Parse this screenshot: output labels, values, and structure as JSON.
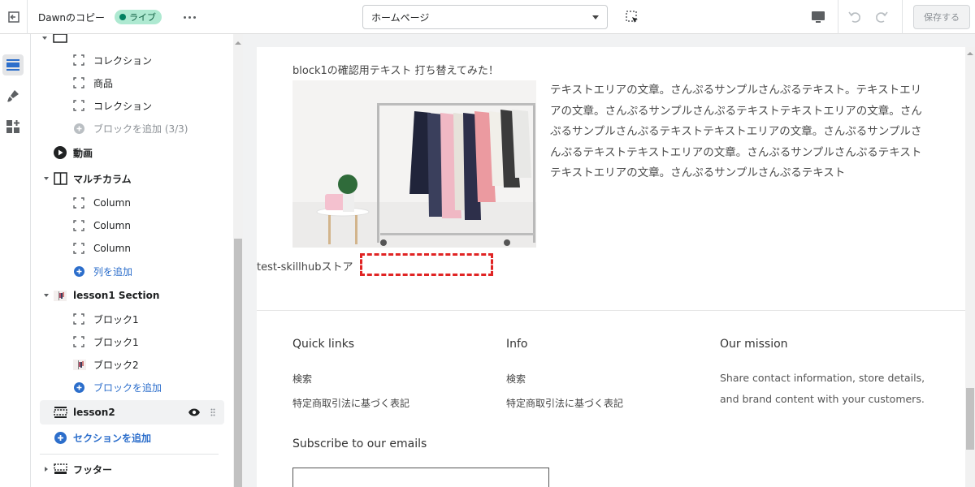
{
  "topbar": {
    "theme_name": "Dawnのコピー",
    "status_badge": "ライブ",
    "page_selector_value": "ホームページ",
    "save_label": "保存する"
  },
  "sidebar": {
    "items": [
      {
        "label": "コレクション",
        "icon": "block-icon"
      },
      {
        "label": "商品",
        "icon": "block-icon"
      },
      {
        "label": "コレクション",
        "icon": "block-icon"
      },
      {
        "label": "ブロックを追加 (3/3)",
        "icon": "add-circle-icon"
      },
      {
        "label": "動画",
        "icon": "play-icon"
      },
      {
        "label": "マルチカラム",
        "icon": "columns-icon"
      },
      {
        "label": "Column",
        "icon": "block-icon"
      },
      {
        "label": "Column",
        "icon": "block-icon"
      },
      {
        "label": "Column",
        "icon": "block-icon"
      },
      {
        "label": "列を追加",
        "icon": "add-circle-icon"
      },
      {
        "label": "lesson1 Section",
        "icon": "image-thumb-icon"
      },
      {
        "label": "ブロック1",
        "icon": "block-icon"
      },
      {
        "label": "ブロック1",
        "icon": "block-icon"
      },
      {
        "label": "ブロック2",
        "icon": "image-thumb-icon"
      },
      {
        "label": "ブロックを追加",
        "icon": "add-circle-icon"
      },
      {
        "label": "lesson2",
        "icon": "section-icon"
      },
      {
        "label": "セクションを追加",
        "icon": "add-circle-icon"
      },
      {
        "label": "フッター",
        "icon": "footer-icon"
      }
    ]
  },
  "preview": {
    "block_caption": "block1の確認用テキスト 打ち替えてみた！",
    "body_text": "テキストエリアの文章。さんぷるサンプルさんぷるテキスト。テキストエリアの文章。さんぷるサンプルさんぷるテキストテキストエリアの文章。さんぷるサンプルさんぷるテキストテキストエリアの文章。さんぷるサンプルさんぷるテキストテキストエリアの文章。さんぷるサンプルさんぷるテキストテキストエリアの文章。さんぷるサンプルさんぷるテキスト",
    "store_label": "test-skillhubストア",
    "footer": {
      "quick_links_heading": "Quick links",
      "quick_links": [
        "検索",
        "特定商取引法に基づく表記"
      ],
      "info_heading": "Info",
      "info_links": [
        "検索",
        "特定商取引法に基づく表記"
      ],
      "mission_heading": "Our mission",
      "mission_text": "Share contact information, store details, and brand content with your customers.",
      "subscribe_heading": "Subscribe to our emails"
    }
  },
  "colors": {
    "accent": "#2c6ecb",
    "live_badge_bg": "#aee9d1",
    "selection_dash": "#e02424"
  }
}
